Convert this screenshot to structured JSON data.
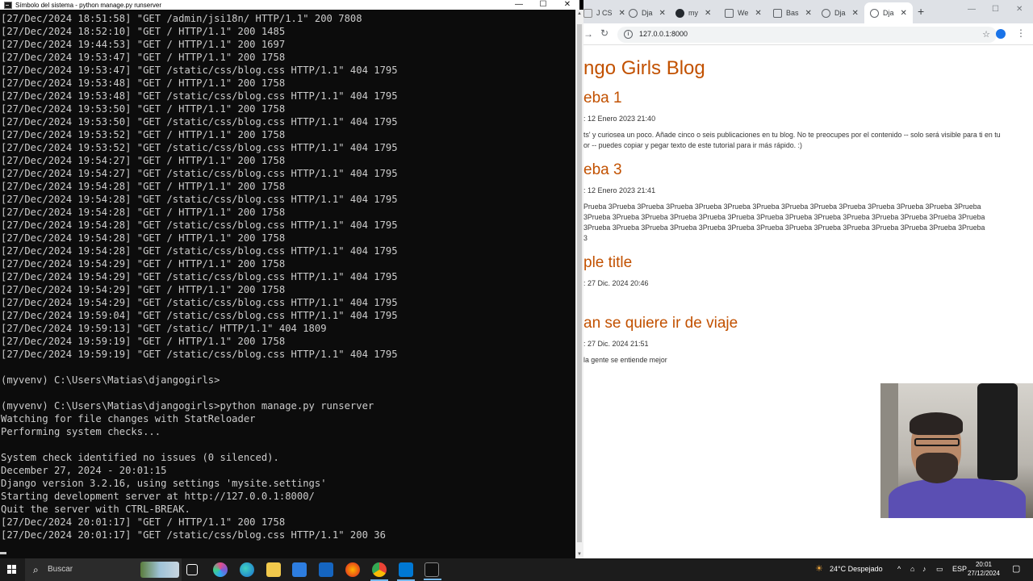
{
  "terminal": {
    "title": "Símbolo del sistema - python  manage.py runserver",
    "controls": {
      "minimize": "—",
      "maximize": "☐",
      "close": "✕"
    },
    "lines": [
      "[27/Dec/2024 18:51:58] \"GET /admin/jsi18n/ HTTP/1.1\" 200 7808",
      "[27/Dec/2024 18:52:10] \"GET / HTTP/1.1\" 200 1485",
      "[27/Dec/2024 19:44:53] \"GET / HTTP/1.1\" 200 1697",
      "[27/Dec/2024 19:53:47] \"GET / HTTP/1.1\" 200 1758",
      "[27/Dec/2024 19:53:47] \"GET /static/css/blog.css HTTP/1.1\" 404 1795",
      "[27/Dec/2024 19:53:48] \"GET / HTTP/1.1\" 200 1758",
      "[27/Dec/2024 19:53:48] \"GET /static/css/blog.css HTTP/1.1\" 404 1795",
      "[27/Dec/2024 19:53:50] \"GET / HTTP/1.1\" 200 1758",
      "[27/Dec/2024 19:53:50] \"GET /static/css/blog.css HTTP/1.1\" 404 1795",
      "[27/Dec/2024 19:53:52] \"GET / HTTP/1.1\" 200 1758",
      "[27/Dec/2024 19:53:52] \"GET /static/css/blog.css HTTP/1.1\" 404 1795",
      "[27/Dec/2024 19:54:27] \"GET / HTTP/1.1\" 200 1758",
      "[27/Dec/2024 19:54:27] \"GET /static/css/blog.css HTTP/1.1\" 404 1795",
      "[27/Dec/2024 19:54:28] \"GET / HTTP/1.1\" 200 1758",
      "[27/Dec/2024 19:54:28] \"GET /static/css/blog.css HTTP/1.1\" 404 1795",
      "[27/Dec/2024 19:54:28] \"GET / HTTP/1.1\" 200 1758",
      "[27/Dec/2024 19:54:28] \"GET /static/css/blog.css HTTP/1.1\" 404 1795",
      "[27/Dec/2024 19:54:28] \"GET / HTTP/1.1\" 200 1758",
      "[27/Dec/2024 19:54:28] \"GET /static/css/blog.css HTTP/1.1\" 404 1795",
      "[27/Dec/2024 19:54:29] \"GET / HTTP/1.1\" 200 1758",
      "[27/Dec/2024 19:54:29] \"GET /static/css/blog.css HTTP/1.1\" 404 1795",
      "[27/Dec/2024 19:54:29] \"GET / HTTP/1.1\" 200 1758",
      "[27/Dec/2024 19:54:29] \"GET /static/css/blog.css HTTP/1.1\" 404 1795",
      "[27/Dec/2024 19:59:04] \"GET /static/css/blog.css HTTP/1.1\" 404 1795",
      "[27/Dec/2024 19:59:13] \"GET /static/ HTTP/1.1\" 404 1809",
      "[27/Dec/2024 19:59:19] \"GET / HTTP/1.1\" 200 1758",
      "[27/Dec/2024 19:59:19] \"GET /static/css/blog.css HTTP/1.1\" 404 1795",
      "",
      "(myvenv) C:\\Users\\Matias\\djangogirls>",
      "",
      "(myvenv) C:\\Users\\Matias\\djangogirls>python manage.py runserver",
      "Watching for file changes with StatReloader",
      "Performing system checks...",
      "",
      "System check identified no issues (0 silenced).",
      "December 27, 2024 - 20:01:15",
      "Django version 3.2.16, using settings 'mysite.settings'",
      "Starting development server at http://127.0.0.1:8000/",
      "Quit the server with CTRL-BREAK.",
      "[27/Dec/2024 20:01:17] \"GET / HTTP/1.1\" 200 1758",
      "[27/Dec/2024 20:01:17] \"GET /static/css/blog.css HTTP/1.1\" 200 36"
    ]
  },
  "browser": {
    "tabs": [
      {
        "label": "J  CS",
        "icon": "edge-icon"
      },
      {
        "label": "Dja",
        "icon": "globe-icon"
      },
      {
        "label": "my",
        "icon": "github-icon"
      },
      {
        "label": "We",
        "icon": "w-icon"
      },
      {
        "label": "Bas",
        "icon": "w-icon"
      },
      {
        "label": "Dja",
        "icon": "globe-icon"
      },
      {
        "label": "Dja",
        "icon": "globe-icon"
      }
    ],
    "new_tab": "+",
    "window_controls": {
      "minimize": "—",
      "maximize": "☐",
      "close": "✕"
    },
    "url": "127.0.0.1:8000",
    "page": {
      "blog_title": "ngo Girls Blog",
      "posts": [
        {
          "title": "eba 1",
          "date": ": 12 Enero 2023 21:40",
          "text": "ts' y curiosea un poco. Añade cinco o seis publicaciones en tu blog. No te preocupes por el contenido -- solo será visible para ti en tu\nor -- puedes copiar y pegar texto de este tutorial para ir más rápido. :)"
        },
        {
          "title": "eba 3",
          "date": ": 12 Enero 2023 21:41",
          "text": "Prueba 3Prueba 3Prueba 3Prueba 3Prueba 3Prueba 3Prueba 3Prueba 3Prueba 3Prueba 3Prueba 3Prueba 3Prueba 3Prueba\n3Prueba 3Prueba 3Prueba 3Prueba 3Prueba 3Prueba 3Prueba 3Prueba 3Prueba 3Prueba 3Prueba 3Prueba 3Prueba 3Prueba\n3Prueba 3Prueba 3Prueba 3Prueba 3Prueba 3Prueba 3Prueba 3Prueba 3Prueba 3Prueba 3Prueba 3Prueba 3Prueba 3Prueba\n3"
        },
        {
          "title": "ple title",
          "date": ": 27 Dic. 2024 20:46",
          "text": ""
        },
        {
          "title": "an se quiere ir de viaje",
          "date": ": 27 Dic. 2024 21:51",
          "text": "la gente se entiende mejor"
        }
      ]
    }
  },
  "taskbar": {
    "search_placeholder": "Buscar",
    "weather": "24°C  Despejado",
    "language": "ESP",
    "time": "20:01",
    "date": "27/12/2024",
    "accent": "#76b9ed"
  }
}
